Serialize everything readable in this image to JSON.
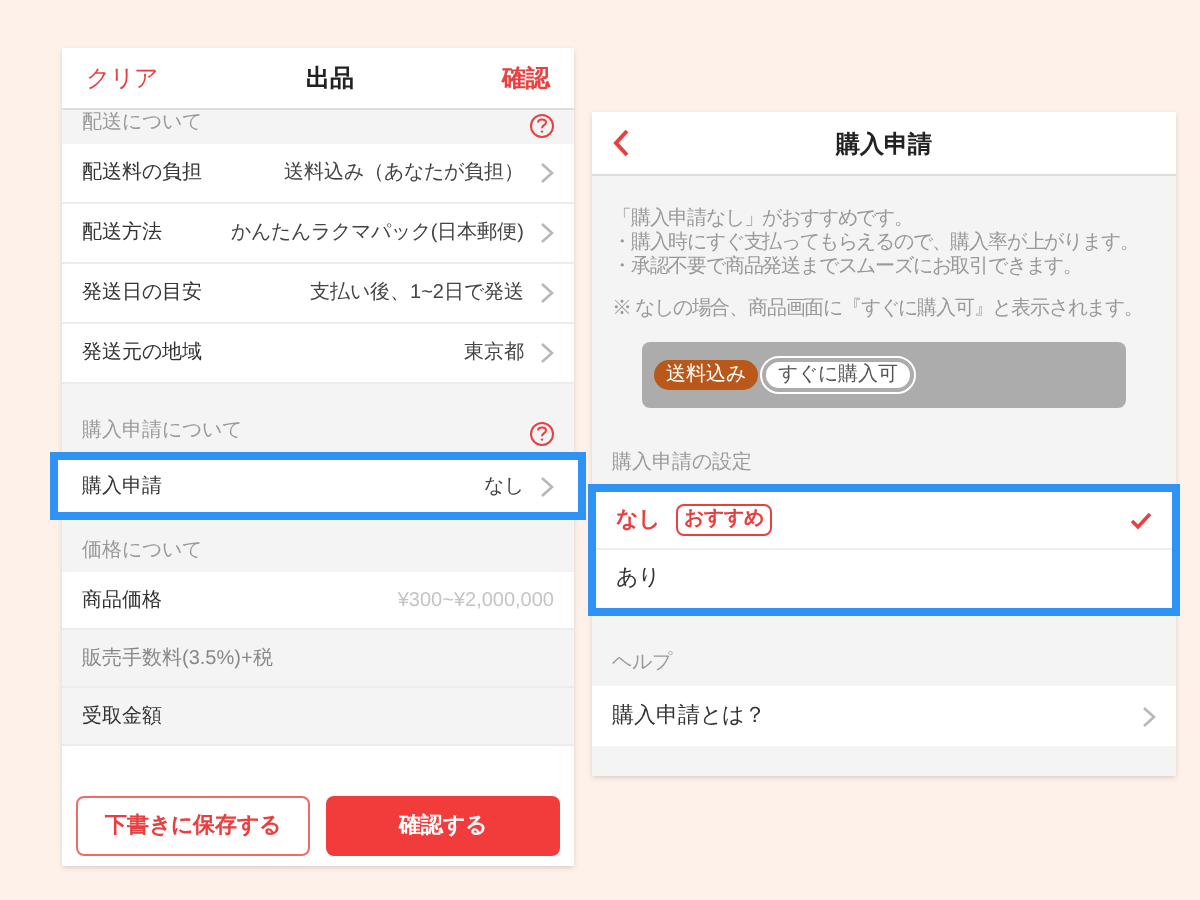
{
  "listing_screen": {
    "header": {
      "left_action": "クリア",
      "title": "出品",
      "right_action": "確認"
    },
    "sections": [
      {
        "title": "配送について",
        "help": true,
        "rows": [
          {
            "kind": "link",
            "label": "配送料の負担",
            "value": "送料込み（あなたが負担）",
            "highlighted": false
          },
          {
            "kind": "link",
            "label": "配送方法",
            "value": "かんたんラクマパック(日本郵便)",
            "highlighted": false
          },
          {
            "kind": "link",
            "label": "発送日の目安",
            "value": "支払い後、1~2日で発送",
            "highlighted": false
          },
          {
            "kind": "link",
            "label": "発送元の地域",
            "value": "東京都",
            "highlighted": false
          }
        ]
      },
      {
        "title": "購入申請について",
        "help": true,
        "rows": [
          {
            "kind": "link",
            "label": "購入申請",
            "value": "なし",
            "highlighted": true
          }
        ]
      },
      {
        "title": "価格について",
        "help": false,
        "rows": [
          {
            "kind": "input",
            "label": "商品価格",
            "placeholder": "¥300~¥2,000,000",
            "highlighted": false
          },
          {
            "kind": "note",
            "label": "販売手数料(3.5%)+税",
            "highlighted": false
          },
          {
            "kind": "plain",
            "label": "受取金額",
            "highlighted": false
          }
        ]
      }
    ],
    "buttons": [
      {
        "kind": "outline",
        "label": "下書きに保存する"
      },
      {
        "kind": "filled",
        "label": "確認する"
      }
    ]
  },
  "request_screen": {
    "header": {
      "title": "購入申請"
    },
    "info_lines": [
      "「購入申請なし」がおすすめです。",
      "・購入時にすぐ支払ってもらえるので、購入率が上がります。",
      "・承認不要で商品発送までスムーズにお取引できます。"
    ],
    "note": "※ なしの場合、商品画面に『すぐに購入可』と表示されます。",
    "preview_tags": [
      {
        "kind": "shipping",
        "label": "送料込み"
      },
      {
        "kind": "instant",
        "label": "すぐに購入可"
      }
    ],
    "setting_title": "購入申請の設定",
    "options_highlighted": true,
    "options": [
      {
        "label": "なし",
        "badge": "おすすめ",
        "selected": true
      },
      {
        "label": "あり",
        "selected": false
      }
    ],
    "help_title": "ヘルプ",
    "help_rows": [
      "購入申請とは？"
    ]
  }
}
